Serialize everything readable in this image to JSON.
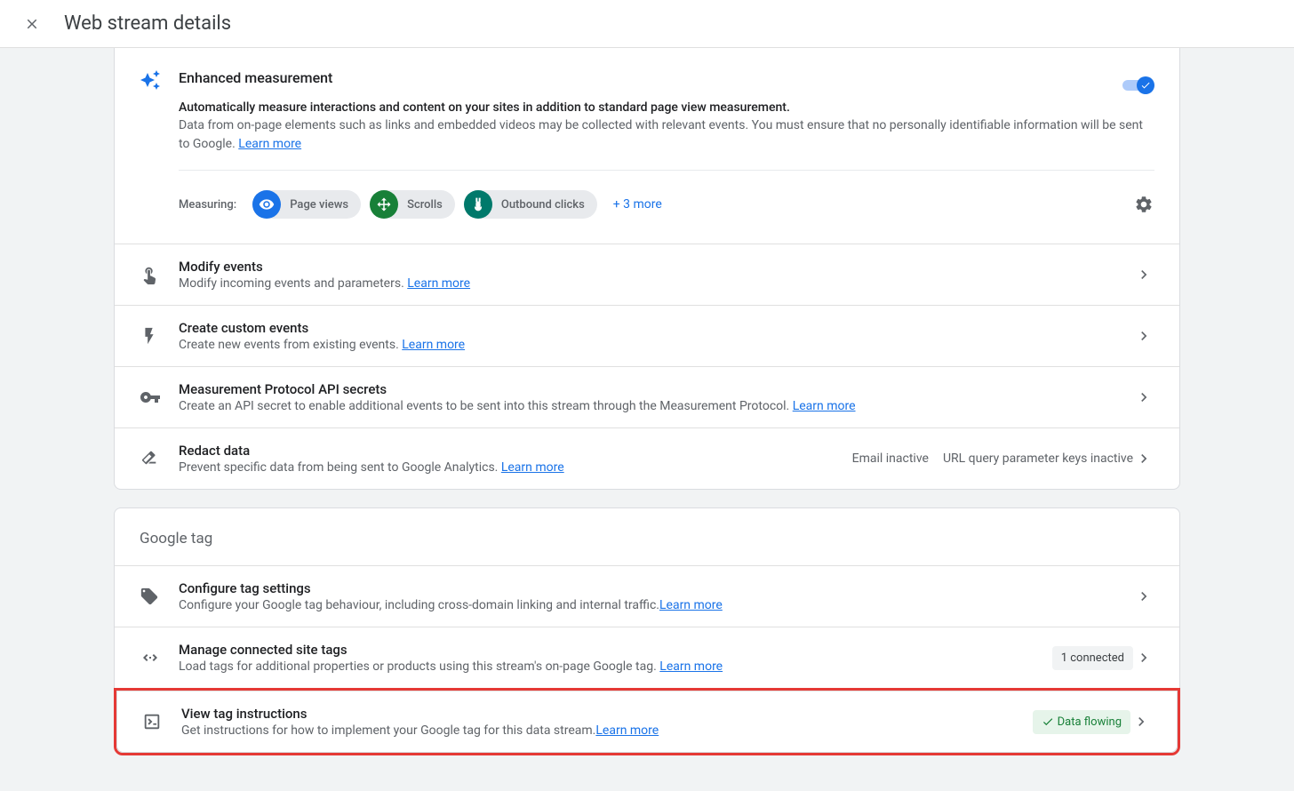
{
  "header": {
    "title": "Web stream details"
  },
  "enhanced": {
    "title": "Enhanced measurement",
    "subtitle": "Automatically measure interactions and content on your sites in addition to standard page view measurement.",
    "description": "Data from on-page elements such as links and embedded videos may be collected with relevant events. You must ensure that no personally identifiable information will be sent to Google.",
    "learn_more": "Learn more",
    "measuring_label": "Measuring:",
    "chips": {
      "page_views": "Page views",
      "scrolls": "Scrolls",
      "outbound": "Outbound clicks"
    },
    "more_link": "+ 3 more"
  },
  "events_rows": {
    "modify": {
      "title": "Modify events",
      "desc": "Modify incoming events and parameters. ",
      "learn": "Learn more"
    },
    "custom": {
      "title": "Create custom events",
      "desc": "Create new events from existing events. ",
      "learn": "Learn more"
    },
    "secrets": {
      "title": "Measurement Protocol API secrets",
      "desc": "Create an API secret to enable additional events to be sent into this stream through the Measurement Protocol. ",
      "learn": "Learn more"
    },
    "redact": {
      "title": "Redact data",
      "desc": "Prevent specific data from being sent to Google Analytics. ",
      "learn": "Learn more",
      "status1": "Email inactive",
      "status2": "URL query parameter keys inactive"
    }
  },
  "google_tag": {
    "header": "Google tag",
    "configure": {
      "title": "Configure tag settings",
      "desc": "Configure your Google tag behaviour, including cross-domain linking and internal traffic.",
      "learn": "Learn more"
    },
    "connected": {
      "title": "Manage connected site tags",
      "desc": "Load tags for additional properties or products using this stream's on-page Google tag. ",
      "learn": "Learn more",
      "badge": "1 connected"
    },
    "instructions": {
      "title": "View tag instructions",
      "desc": "Get instructions for how to implement your Google tag for this data stream.",
      "learn": "Learn more",
      "status": "Data flowing"
    }
  }
}
